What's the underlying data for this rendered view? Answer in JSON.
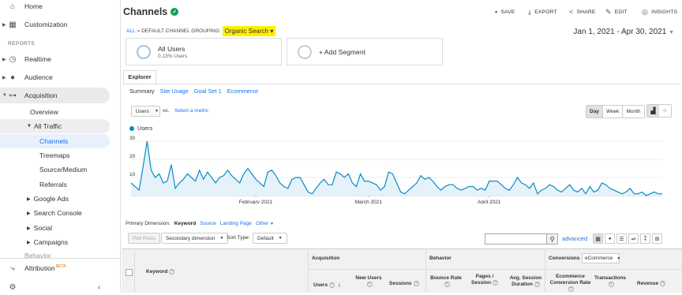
{
  "sidebar": {
    "home": "Home",
    "customization": "Customization",
    "reports_label": "REPORTS",
    "realtime": "Realtime",
    "audience": "Audience",
    "acquisition": "Acquisition",
    "overview": "Overview",
    "all_traffic": "All Traffic",
    "channels": "Channels",
    "treemaps": "Treemaps",
    "source_medium": "Source/Medium",
    "referrals": "Referrals",
    "google_ads": "Google Ads",
    "search_console": "Search Console",
    "social": "Social",
    "campaigns": "Campaigns",
    "behavior": "Behavior",
    "attribution": "Attribution",
    "beta": "BETA"
  },
  "header": {
    "title": "Channels",
    "save": "SAVE",
    "export": "EXPORT",
    "share": "SHARE",
    "edit": "EDIT",
    "insights": "INSIGHTS"
  },
  "breadcrumb": {
    "all": "ALL",
    "sep": "»",
    "grouping": "DEFAULT CHANNEL GROUPING:",
    "value": "Organic Search",
    "caret": "▾"
  },
  "date_range": "Jan 1, 2021 - Apr 30, 2021",
  "segments": {
    "all_users": "All Users",
    "pct": "0.13% Users",
    "add": "+ Add Segment"
  },
  "tabs": {
    "explorer": "Explorer",
    "subtabs": [
      "Summary",
      "Site Usage",
      "Goal Set 1",
      "Ecommerce"
    ]
  },
  "metric": {
    "selected": "Users",
    "vs": "vs.",
    "select": "Select a metric"
  },
  "granularity": [
    "Day",
    "Week",
    "Month"
  ],
  "chart_data": {
    "type": "area",
    "series": [
      {
        "name": "Users",
        "values": [
          7,
          5,
          3,
          16,
          30,
          14,
          10,
          12,
          7,
          8,
          17,
          4,
          7,
          9,
          12,
          10,
          8,
          14,
          9,
          13,
          10,
          7,
          10,
          11,
          14,
          11,
          9,
          7,
          12,
          15,
          12,
          9,
          7,
          5,
          13,
          14,
          11,
          7,
          5,
          4,
          9,
          10,
          10,
          6,
          2,
          1,
          4,
          7,
          9,
          6,
          6,
          13,
          12,
          10,
          12,
          7,
          5,
          12,
          8,
          8,
          7,
          6,
          3,
          5,
          13,
          12,
          7,
          2,
          1,
          3,
          5,
          7,
          11,
          9,
          10,
          8,
          5,
          3,
          5,
          6,
          6,
          4,
          3,
          4,
          5,
          5,
          3,
          4,
          3,
          8,
          8,
          8,
          6,
          4,
          3,
          6,
          10,
          7,
          6,
          4,
          7,
          1,
          3,
          4,
          6,
          5,
          3,
          2,
          4,
          6,
          3,
          2,
          4,
          1,
          5,
          2,
          3,
          7,
          6,
          4,
          3,
          2,
          1,
          2,
          4,
          1,
          1,
          2,
          0,
          1,
          2,
          1,
          1
        ]
      }
    ],
    "yticks": [
      10,
      20,
      30
    ],
    "xlabels": [
      "February 2021",
      "March 2021",
      "April 2021"
    ],
    "ylim": [
      0,
      33
    ]
  },
  "table": {
    "primary_label": "Primary Dimension:",
    "primary_keyword": "Keyword",
    "source": "Source",
    "landing": "Landing Page",
    "other": "Other",
    "plot_rows": "Plot Rows",
    "secondary": "Secondary dimension",
    "sort_type": "Sort Type:",
    "default": "Default",
    "advanced": "advanced",
    "groups": {
      "acq": "Acquisition",
      "beh": "Behavior",
      "conv": "Conversions",
      "conv_sel": "eCommerce"
    },
    "cols": {
      "keyword": "Keyword",
      "users": "Users",
      "new_users": "New Users",
      "sessions": "Sessions",
      "bounce": "Bounce Rate",
      "pages": "Pages / Session",
      "duration": "Avg. Session Duration",
      "ecr": "Ecommerce Conversion Rate",
      "transactions": "Transactions",
      "revenue": "Revenue"
    }
  }
}
